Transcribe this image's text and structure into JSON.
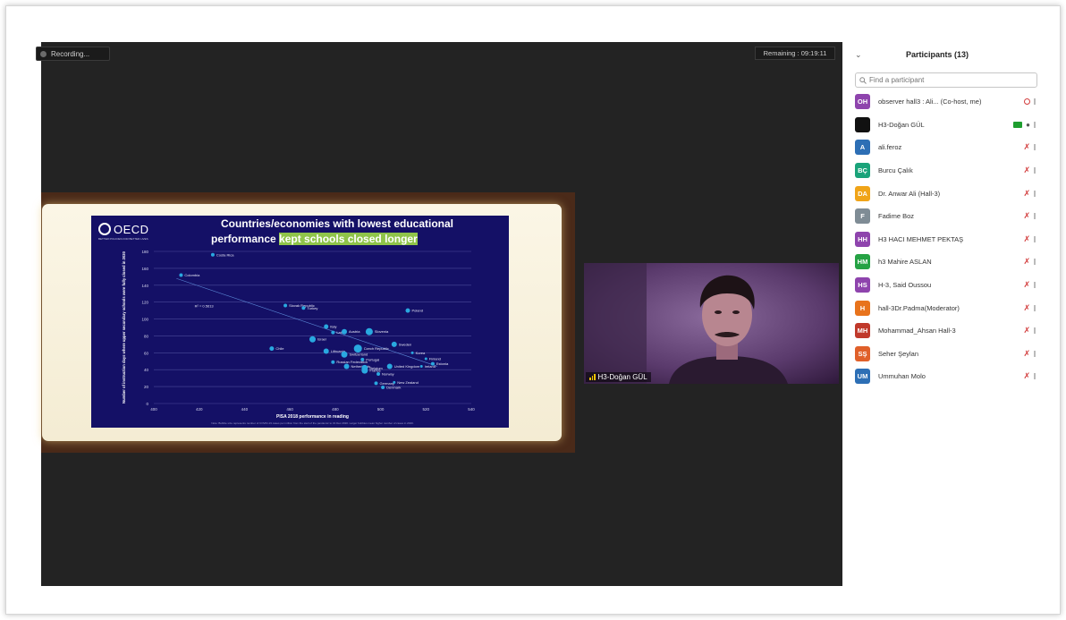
{
  "meeting": {
    "recording_label": "Recording...",
    "remaining_label": "Remaining : 09:19:11"
  },
  "slide": {
    "logo_text": "OECD",
    "logo_tagline": "BETTER POLICIES FOR BETTER LIVES",
    "title_line1": "Countries/economies with lowest educational",
    "title_line2_plain": "performance ",
    "title_line2_highlight": "kept schools closed longer"
  },
  "chart_data": {
    "type": "scatter",
    "title": "Countries/economies with lowest educational performance kept schools closed longer",
    "xlabel": "PISA 2018 performance in reading",
    "ylabel": "Number of instruction days where upper secondary schools were fully closed in 2020",
    "xlim": [
      400,
      540
    ],
    "ylim": [
      0,
      180
    ],
    "x_ticks": [
      400,
      420,
      440,
      460,
      480,
      500,
      520,
      540
    ],
    "y_ticks": [
      0,
      20,
      40,
      60,
      80,
      100,
      120,
      140,
      160,
      180
    ],
    "annotation": "R² = 0.5613",
    "note": "Note: Bubble size represents number of COVID-19 cases per million from the start of the pandemic to 31 Dec 2020. Larger bubbles mean higher number of cases in 2020.",
    "grid": true,
    "points": [
      {
        "label": "Costa Rica",
        "x": 426,
        "y": 176,
        "r": 2
      },
      {
        "label": "Colombia",
        "x": 412,
        "y": 152,
        "r": 2
      },
      {
        "label": "Slovak Republic",
        "x": 458,
        "y": 116,
        "r": 2
      },
      {
        "label": "Turkey",
        "x": 466,
        "y": 113,
        "r": 2
      },
      {
        "label": "Poland",
        "x": 512,
        "y": 110,
        "r": 2.5
      },
      {
        "label": "Italy",
        "x": 476,
        "y": 91,
        "r": 2.5
      },
      {
        "label": "Latvia",
        "x": 479,
        "y": 84,
        "r": 2
      },
      {
        "label": "Slovenia",
        "x": 495,
        "y": 85,
        "r": 4
      },
      {
        "label": "Austria",
        "x": 484,
        "y": 85,
        "r": 3
      },
      {
        "label": "Israel",
        "x": 470,
        "y": 76,
        "r": 3.5
      },
      {
        "label": "Sweden",
        "x": 506,
        "y": 70,
        "r": 3
      },
      {
        "label": "Chile",
        "x": 452,
        "y": 65,
        "r": 2.5
      },
      {
        "label": "Lithuania",
        "x": 476,
        "y": 62,
        "r": 3
      },
      {
        "label": "Czech Republic",
        "x": 490,
        "y": 65,
        "r": 4.5
      },
      {
        "label": "Switzerland",
        "x": 484,
        "y": 58,
        "r": 3.5
      },
      {
        "label": "Korea",
        "x": 514,
        "y": 60,
        "r": 1.5
      },
      {
        "label": "Finland",
        "x": 520,
        "y": 53,
        "r": 1.5
      },
      {
        "label": "Portugal",
        "x": 492,
        "y": 52,
        "r": 2
      },
      {
        "label": "Estonia",
        "x": 523,
        "y": 47,
        "r": 2
      },
      {
        "label": "Russian Federation",
        "x": 479,
        "y": 49,
        "r": 2
      },
      {
        "label": "Netherlands",
        "x": 485,
        "y": 44,
        "r": 3
      },
      {
        "label": "Belgium",
        "x": 493,
        "y": 42,
        "r": 3.5
      },
      {
        "label": "United Kingdom",
        "x": 504,
        "y": 44,
        "r": 3
      },
      {
        "label": "Ireland",
        "x": 518,
        "y": 44,
        "r": 1.5
      },
      {
        "label": "France",
        "x": 493,
        "y": 39,
        "r": 3.5
      },
      {
        "label": "Norway",
        "x": 499,
        "y": 35,
        "r": 2
      },
      {
        "label": "Germany",
        "x": 498,
        "y": 24,
        "r": 2
      },
      {
        "label": "New Zealand",
        "x": 506,
        "y": 25,
        "r": 1.5
      },
      {
        "label": "Denmark",
        "x": 501,
        "y": 19,
        "r": 2
      }
    ],
    "trendline": [
      [
        410,
        148
      ],
      [
        525,
        44
      ]
    ]
  },
  "video": {
    "name_label": "H3-Doğan GÜL"
  },
  "participants_panel": {
    "title": "Participants (13)",
    "search_placeholder": "Find a participant",
    "participants": [
      {
        "initials": "OH",
        "name": "observer hall3 : Ali... (Co-host, me)",
        "color": "#8e44ad",
        "status": "recording"
      },
      {
        "initials": "",
        "name": "H3-Doğan GÜL",
        "color": "#111111",
        "status": "video-on"
      },
      {
        "initials": "A",
        "name": "ali.feroz",
        "color": "#2d6fb5",
        "status": "muted"
      },
      {
        "initials": "BÇ",
        "name": "Burcu Çalık",
        "color": "#1aa37a",
        "status": "muted"
      },
      {
        "initials": "DA",
        "name": "Dr. Anwar Ali (Hall-3)",
        "color": "#f0a418",
        "status": "muted"
      },
      {
        "initials": "F",
        "name": "Fadime Boz",
        "color": "#7f8c95",
        "status": "muted"
      },
      {
        "initials": "HH",
        "name": "H3 HACI MEHMET PEKTAŞ",
        "color": "#8e44ad",
        "status": "muted"
      },
      {
        "initials": "HM",
        "name": "h3 Mahire ASLAN",
        "color": "#25a244",
        "status": "muted"
      },
      {
        "initials": "HS",
        "name": "H-3, Said Oussou",
        "color": "#8e44ad",
        "status": "muted"
      },
      {
        "initials": "H",
        "name": "hall-3Dr.Padma(Moderator)",
        "color": "#e8731c",
        "status": "muted"
      },
      {
        "initials": "MH",
        "name": "Mohammad_Ahsan Hall-3",
        "color": "#c0392b",
        "status": "muted"
      },
      {
        "initials": "SŞ",
        "name": "Seher Şeylan",
        "color": "#e0602a",
        "status": "muted"
      },
      {
        "initials": "UM",
        "name": "Ummuhan Molo",
        "color": "#2d6fb5",
        "status": "muted"
      }
    ]
  }
}
